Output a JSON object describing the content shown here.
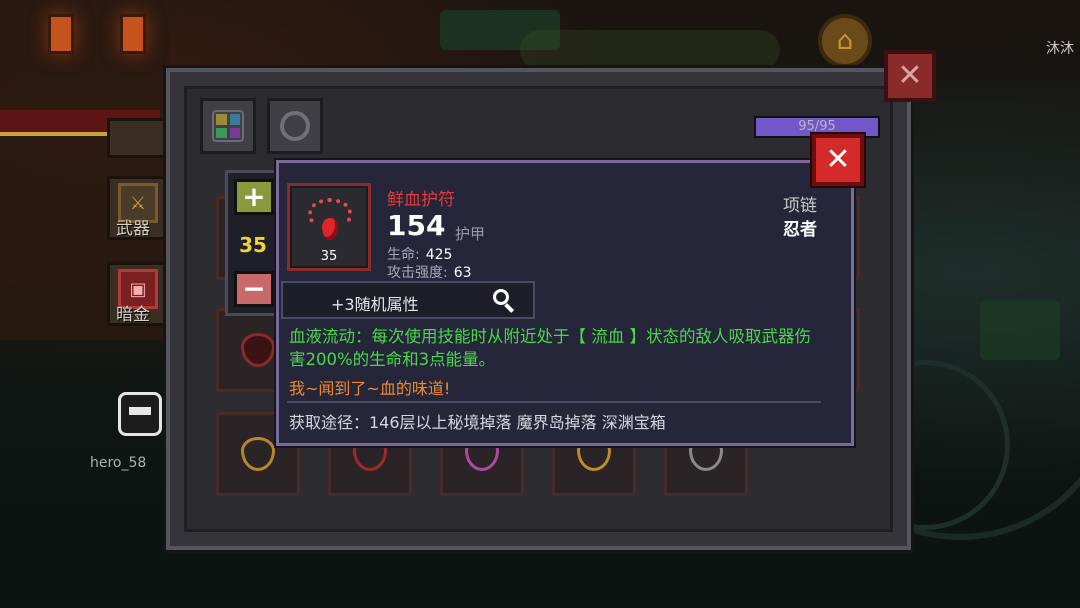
{
  "background": {
    "corner_name": "沐沐",
    "side_buttons": [
      {
        "label": "武器"
      },
      {
        "label": "暗金"
      }
    ],
    "player_tag": "hero_58"
  },
  "bag": {
    "energy": {
      "text": "95/95",
      "fill_fraction": 1.0
    }
  },
  "quantity": {
    "value": "35"
  },
  "item": {
    "name": "鲜血护符",
    "count": "35",
    "main_stat_value": "154",
    "main_stat_label": "护甲",
    "sub_stats": [
      {
        "label": "生命:",
        "value": "425"
      },
      {
        "label": "攻击强度:",
        "value": "63"
      }
    ],
    "slot_type": "项链",
    "class": "忍者",
    "random_attr": "+3随机属性",
    "skill_text": "血液流动：每次使用技能时从附近处于【 流血 】状态的敌人吸取武器伤害200%的生命和3点能量。",
    "flavor_text": "我~闻到了~血的味道!",
    "source_text": "获取途径：146层以上秘境掉落 魔界岛掉落 深渊宝箱"
  },
  "colors": {
    "item_name": "#e83a3a",
    "skill_text": "#4ad84a",
    "flavor_text": "#f08a2a",
    "quantity_value": "#f2d23a",
    "close_button": "#d42a2a",
    "energy_fill": "#7058c8"
  },
  "icons": {
    "close": "close-icon",
    "plus": "plus-icon",
    "minus": "minus-icon",
    "search": "magnifier-icon",
    "home": "home-icon",
    "item": "blood-amulet-icon"
  }
}
